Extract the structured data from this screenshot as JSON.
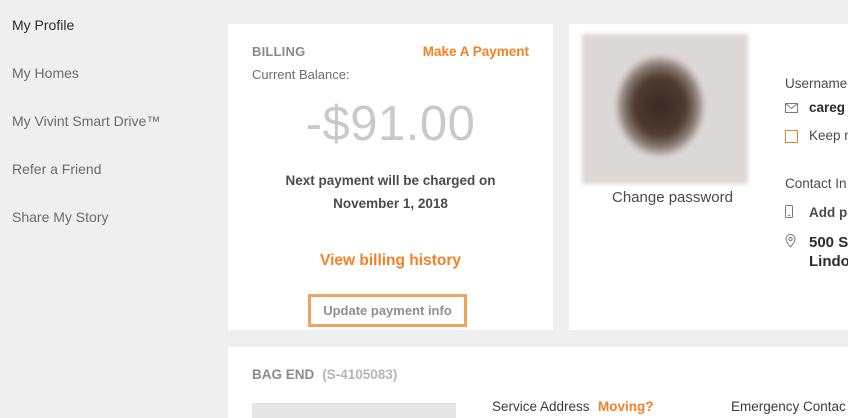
{
  "sidebar": {
    "items": [
      {
        "label": "My Profile"
      },
      {
        "label": "My Homes"
      },
      {
        "label": "My Vivint Smart Drive™"
      },
      {
        "label": "Refer a Friend"
      },
      {
        "label": "Share My Story"
      }
    ]
  },
  "billing": {
    "title": "BILLING",
    "make_payment": "Make A Payment",
    "current_balance_label": "Current Balance:",
    "balance": "-$91.00",
    "next_payment_line1": "Next payment will be charged on",
    "next_payment_line2": "November 1, 2018",
    "view_history": "View billing history",
    "update_payment": "Update payment info"
  },
  "profile": {
    "change_password": "Change password",
    "username_label": "Username",
    "email": "careg",
    "keep_label": "Keep n",
    "contact_label": "Contact In",
    "add_phone": "Add pl",
    "address_line1": "500 S",
    "address_line2": "Lindo"
  },
  "home": {
    "name": "BAG END",
    "id": "(S-4105083)",
    "service_address_label": "Service Address",
    "moving_link": "Moving?",
    "emergency_label": "Emergency Contac"
  },
  "colors": {
    "accent": "#f48024",
    "page_bg": "#efefef",
    "card_bg": "#ffffff"
  }
}
